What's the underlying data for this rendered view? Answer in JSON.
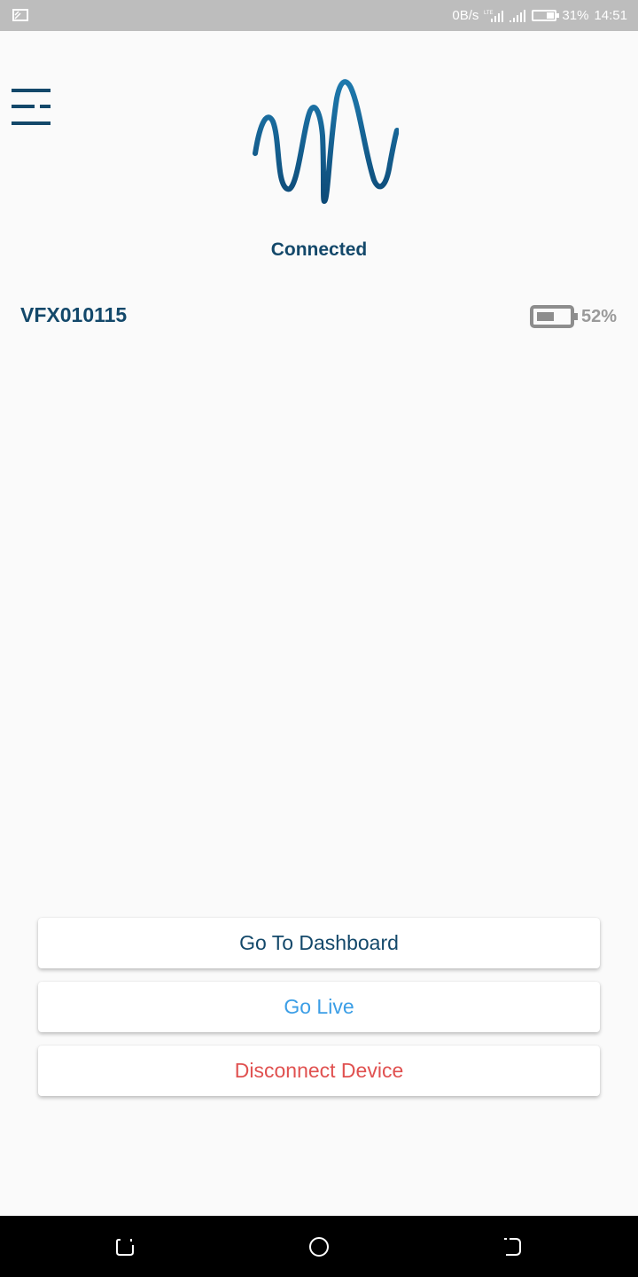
{
  "status_bar": {
    "network_speed": "0B/s",
    "network_type": "LTE",
    "battery_percent": "31%",
    "time": "14:51",
    "icons": [
      "cast-icon",
      "signal-icon",
      "signal-icon",
      "battery-icon"
    ]
  },
  "header": {
    "menu_icon": "menu-icon",
    "logo_icon": "wave-logo"
  },
  "connection": {
    "status": "Connected"
  },
  "device": {
    "id": "VFX010115",
    "battery_percent": "52%",
    "battery_level": 0.52
  },
  "actions": {
    "dashboard": "Go To Dashboard",
    "live": "Go Live",
    "disconnect": "Disconnect Device"
  },
  "colors": {
    "primary": "#13486a",
    "live": "#3b9ee6",
    "disconnect": "#e05150",
    "background": "#fafafa",
    "status_bar": "#bdbdbd"
  },
  "nav_bar": {
    "icons": [
      "recents-icon",
      "home-icon",
      "back-icon"
    ]
  }
}
